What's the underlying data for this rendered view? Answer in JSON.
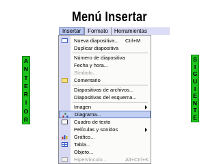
{
  "title": "Menú Insertar",
  "left_button": {
    "letters": [
      "A",
      "N",
      "T",
      "E",
      "R",
      "I",
      "O",
      "R"
    ]
  },
  "right_button": {
    "letters": [
      "S",
      "I",
      "G",
      "U",
      "I",
      "E",
      "N",
      "T",
      "E"
    ]
  },
  "menubar": {
    "items": [
      "Insertar",
      "Formato",
      "Herramientas"
    ]
  },
  "menu": {
    "items": [
      {
        "label": "Nueva diapositiva...",
        "shortcut": "Ctrl+M",
        "icon": "new-slide-icon"
      },
      {
        "label": "Duplicar diapositiva",
        "shortcut": "",
        "icon": ""
      },
      {
        "label": "Número de diapositiva",
        "shortcut": "",
        "icon": ""
      },
      {
        "label": "Fecha y hora...",
        "shortcut": "",
        "icon": ""
      },
      {
        "label": "Símbolo...",
        "shortcut": "",
        "icon": "",
        "disabled": true
      },
      {
        "label": "Comentario",
        "shortcut": "",
        "icon": "comment-icon"
      },
      {
        "label": "Diapositivas de archivos...",
        "shortcut": "",
        "icon": ""
      },
      {
        "label": "Diapositivas del esquema...",
        "shortcut": "",
        "icon": ""
      },
      {
        "label": "Imagen",
        "shortcut": "",
        "icon": "",
        "submenu": true
      },
      {
        "label": "Diagrama...",
        "shortcut": "",
        "icon": "diagram-icon",
        "highlighted": true
      },
      {
        "label": "Cuadro de texto",
        "shortcut": "",
        "icon": "text-box-icon"
      },
      {
        "label": "Películas y sonidos",
        "shortcut": "",
        "icon": "",
        "submenu": true
      },
      {
        "label": "Gráfico...",
        "shortcut": "",
        "icon": "chart-icon"
      },
      {
        "label": "Tabla...",
        "shortcut": "",
        "icon": "table-icon"
      },
      {
        "label": "Objeto...",
        "shortcut": "",
        "icon": ""
      },
      {
        "label": "Hipervínculo...",
        "shortcut": "Alt+Ctrl+K",
        "icon": "hyperlink-icon",
        "disabled": true
      }
    ]
  },
  "colors": {
    "side_button": "#1ec41e",
    "menubar": "#dbdcf5",
    "highlight": "#c1d0f2"
  }
}
